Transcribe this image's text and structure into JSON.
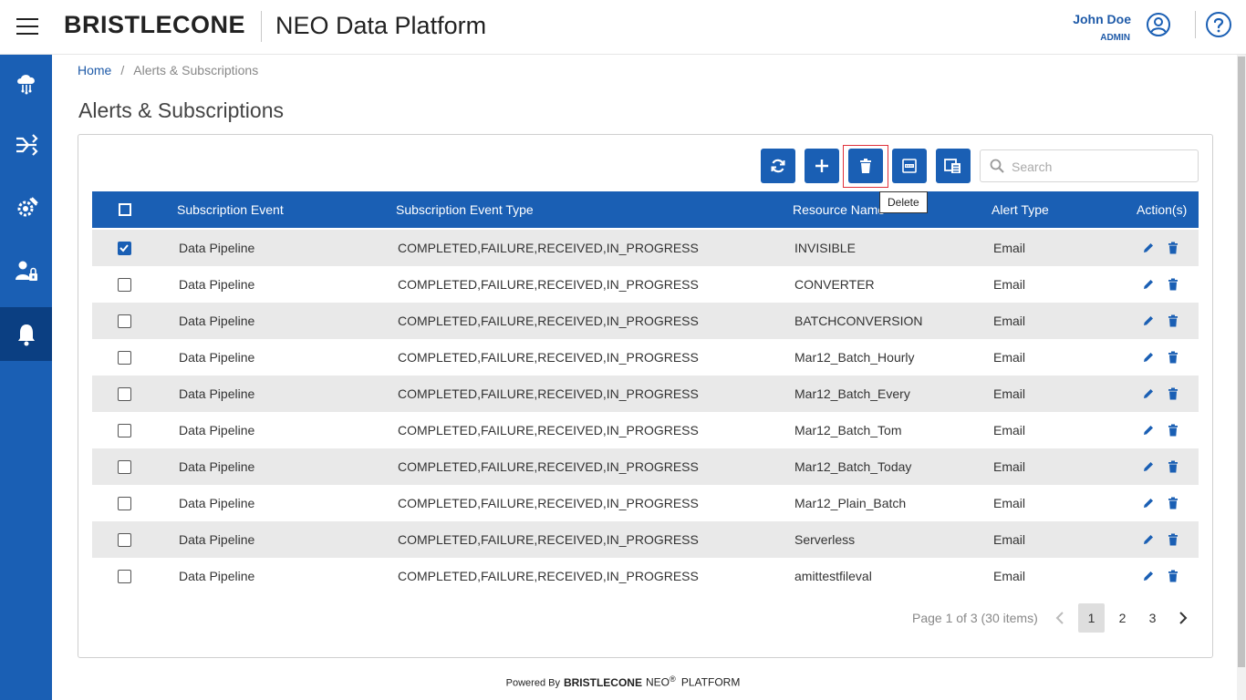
{
  "header": {
    "logo_text": "BRISTLECONE",
    "app_title": "NEO Data Platform",
    "user_name": "John Doe",
    "user_role": "ADMIN"
  },
  "sidebar": {
    "items": [
      {
        "icon": "cloud-network-icon",
        "active": false
      },
      {
        "icon": "pipeline-flow-icon",
        "active": false
      },
      {
        "icon": "settings-tools-icon",
        "active": false
      },
      {
        "icon": "user-admin-icon",
        "active": false
      },
      {
        "icon": "bell-icon",
        "active": true
      }
    ]
  },
  "breadcrumb": {
    "home": "Home",
    "separator": "/",
    "current": "Alerts & Subscriptions"
  },
  "page_title": "Alerts & Subscriptions",
  "toolbar": {
    "buttons": [
      "refresh-icon",
      "add-icon",
      "delete-icon",
      "csv-export-icon",
      "copy-icon"
    ],
    "tooltip": "Delete",
    "search_placeholder": "Search"
  },
  "table": {
    "columns": [
      "Subscription Event",
      "Subscription Event Type",
      "Resource Name",
      "Alert Type",
      "Action(s)"
    ],
    "rows": [
      {
        "checked": true,
        "event": "Data Pipeline",
        "type": "COMPLETED,FAILURE,RECEIVED,IN_PROGRESS",
        "resource": "INVISIBLE",
        "alert": "Email"
      },
      {
        "checked": false,
        "event": "Data Pipeline",
        "type": "COMPLETED,FAILURE,RECEIVED,IN_PROGRESS",
        "resource": "CONVERTER",
        "alert": "Email"
      },
      {
        "checked": false,
        "event": "Data Pipeline",
        "type": "COMPLETED,FAILURE,RECEIVED,IN_PROGRESS",
        "resource": "BATCHCONVERSION",
        "alert": "Email"
      },
      {
        "checked": false,
        "event": "Data Pipeline",
        "type": "COMPLETED,FAILURE,RECEIVED,IN_PROGRESS",
        "resource": "Mar12_Batch_Hourly",
        "alert": "Email"
      },
      {
        "checked": false,
        "event": "Data Pipeline",
        "type": "COMPLETED,FAILURE,RECEIVED,IN_PROGRESS",
        "resource": "Mar12_Batch_Every",
        "alert": "Email"
      },
      {
        "checked": false,
        "event": "Data Pipeline",
        "type": "COMPLETED,FAILURE,RECEIVED,IN_PROGRESS",
        "resource": "Mar12_Batch_Tom",
        "alert": "Email"
      },
      {
        "checked": false,
        "event": "Data Pipeline",
        "type": "COMPLETED,FAILURE,RECEIVED,IN_PROGRESS",
        "resource": "Mar12_Batch_Today",
        "alert": "Email"
      },
      {
        "checked": false,
        "event": "Data Pipeline",
        "type": "COMPLETED,FAILURE,RECEIVED,IN_PROGRESS",
        "resource": "Mar12_Plain_Batch",
        "alert": "Email"
      },
      {
        "checked": false,
        "event": "Data Pipeline",
        "type": "COMPLETED,FAILURE,RECEIVED,IN_PROGRESS",
        "resource": "Serverless",
        "alert": "Email"
      },
      {
        "checked": false,
        "event": "Data Pipeline",
        "type": "COMPLETED,FAILURE,RECEIVED,IN_PROGRESS",
        "resource": "amittestfileval",
        "alert": "Email"
      }
    ]
  },
  "pagination": {
    "summary": "Page 1 of 3 (30 items)",
    "pages": [
      "1",
      "2",
      "3"
    ],
    "current": "1"
  },
  "footer": {
    "powered_by": "Powered By",
    "brand": "BRISTLECONE",
    "product": "NEO",
    "registered": "®",
    "suffix": "PLATFORM"
  },
  "colors": {
    "primary": "#1a5fb4",
    "sidebar_active": "#0b3f82",
    "row_alt": "#e9e9e9",
    "focus_outline": "#e0303a"
  }
}
